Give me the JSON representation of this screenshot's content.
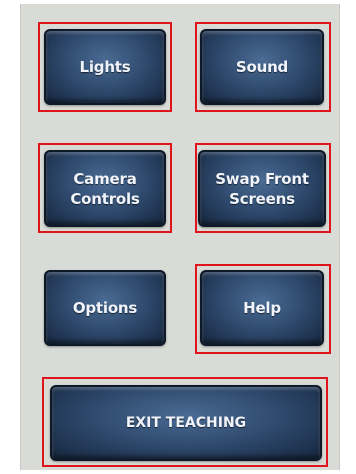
{
  "buttons": {
    "lights": "Lights",
    "sound": "Sound",
    "camera_controls": "Camera\nControls",
    "swap_front_screens": "Swap Front\nScreens",
    "options": "Options",
    "help": "Help",
    "exit_teaching": "EXIT TEACHING"
  },
  "colors": {
    "highlight": "#e0141c",
    "button_base": "#2c4669",
    "panel_bg": "#d9dbd6"
  }
}
